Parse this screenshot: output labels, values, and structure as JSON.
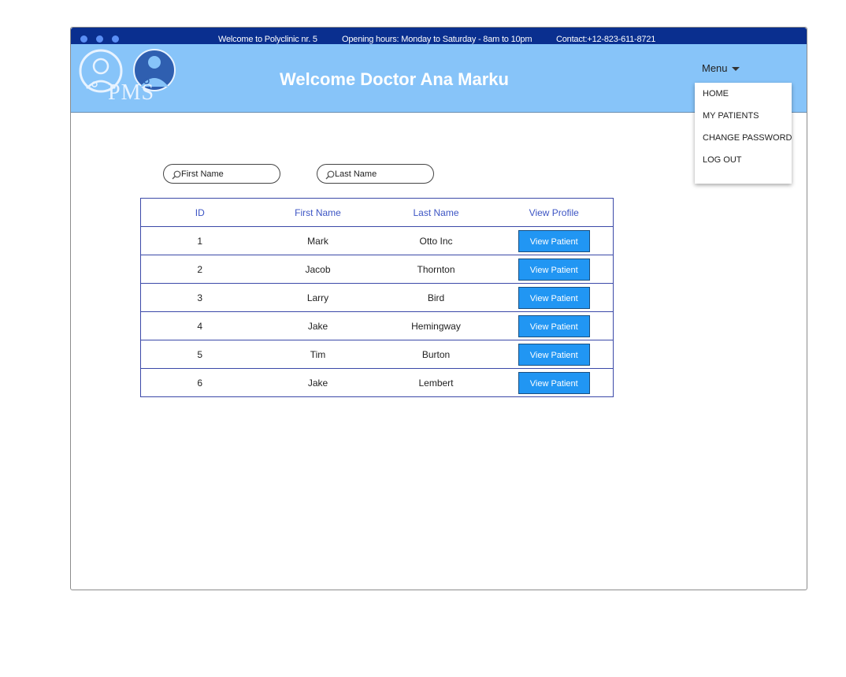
{
  "topbar": {
    "welcome": "Welcome to Polyclinic nr. 5",
    "hours": "Opening hours: Monday to Saturday - 8am to 10pm",
    "contact": "Contact:+12-823-611-8721"
  },
  "header": {
    "logo_text": "PMS",
    "title": "Welcome Doctor Ana Marku"
  },
  "menu": {
    "label": "Menu",
    "items": [
      "HOME",
      "MY PATIENTS",
      "CHANGE PASSWORD",
      "LOG OUT"
    ]
  },
  "search": {
    "first_name_placeholder": "First Name",
    "last_name_placeholder": "Last Name"
  },
  "table": {
    "headers": [
      "ID",
      "First Name",
      "Last Name",
      "View Profile"
    ],
    "rows": [
      {
        "id": "1",
        "first": "Mark",
        "last": "Otto Inc",
        "action": "View Patient"
      },
      {
        "id": "2",
        "first": "Jacob",
        "last": "Thornton",
        "action": "View Patient"
      },
      {
        "id": "3",
        "first": "Larry",
        "last": "Bird",
        "action": "View Patient"
      },
      {
        "id": "4",
        "first": "Jake",
        "last": "Hemingway",
        "action": "View Patient"
      },
      {
        "id": "5",
        "first": "Tim",
        "last": "Burton",
        "action": "View Patient"
      },
      {
        "id": "6",
        "first": "Jake",
        "last": "Lembert",
        "action": "View Patient"
      }
    ]
  },
  "colors": {
    "topbar": "#0a2f8f",
    "header": "#87c4f9",
    "button": "#2196f3",
    "table_border": "#3b49a8"
  }
}
